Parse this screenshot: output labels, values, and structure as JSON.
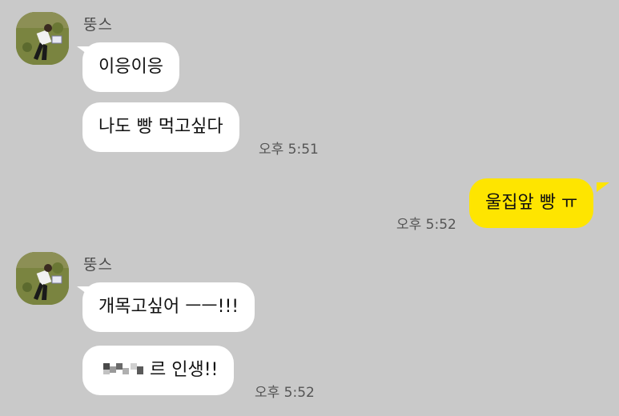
{
  "chat": {
    "sender_name": "뚱스",
    "group1": {
      "messages": [
        "이응이응",
        "나도 빵 먹고싶다"
      ],
      "time": "오후 5:51"
    },
    "mine": {
      "message": "울집앞 빵 ㅠ",
      "time": "오후 5:52"
    },
    "group2": {
      "messages": [
        "개목고싶어 ㅡㅡ!!!",
        "르 인생!!"
      ],
      "time": "오후 5:52"
    }
  },
  "colors": {
    "background": "#c9c9c9",
    "incoming_bubble": "#ffffff",
    "outgoing_bubble": "#fee500"
  },
  "icons": {
    "avatar": "profile-photo-person-lying-on-grass",
    "redaction": "pixelated-censor-mosaic"
  }
}
